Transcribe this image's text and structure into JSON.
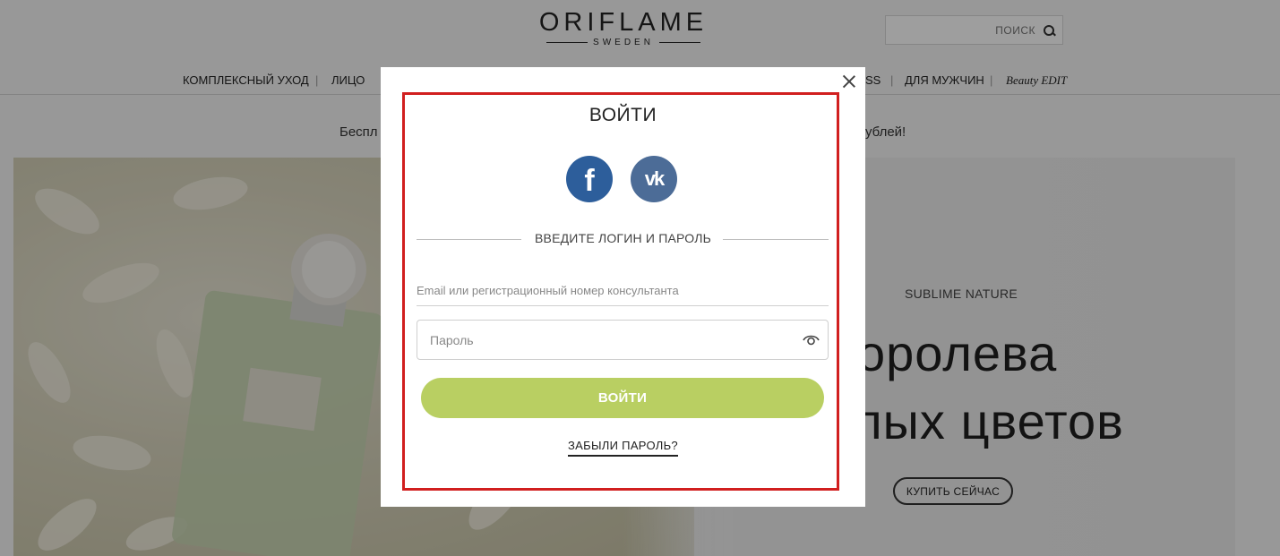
{
  "header": {
    "logo_text": "ORIFLAME",
    "logo_sub": "SWEDEN",
    "search_placeholder": "ПОИСК"
  },
  "nav": {
    "items": [
      "КОМПЛЕКСНЫЙ УХОД",
      "ЛИЦО",
      "SS",
      "ДЛЯ МУЖЧИН",
      "Beauty EDIT"
    ]
  },
  "promo": {
    "left_fragment": "Беспл",
    "right_fragment": "ублей!"
  },
  "hero": {
    "subtitle": "SUBLIME NATURE",
    "title_line1": "оролева",
    "title_line2": "лых цветов",
    "buy_label": "КУПИТЬ СЕЙЧАС"
  },
  "modal": {
    "title": "ВОЙТИ",
    "social": {
      "facebook_label": "f",
      "vk_label": "vk"
    },
    "divider_text": "ВВЕДИТЕ ЛОГИН И ПАРОЛЬ",
    "email_placeholder": "Email или регистрационный номер консультанта",
    "password_placeholder": "Пароль",
    "login_label": "ВОЙТИ",
    "forgot_label": "ЗАБЫЛИ ПАРОЛЬ?"
  },
  "icons": {
    "close": "close-icon",
    "eye": "eye-icon",
    "search": "search-icon"
  },
  "colors": {
    "login_button": "#b9cf62",
    "facebook": "#2d5e9b",
    "vk": "#4c6c97",
    "highlight": "#d11f1f"
  }
}
